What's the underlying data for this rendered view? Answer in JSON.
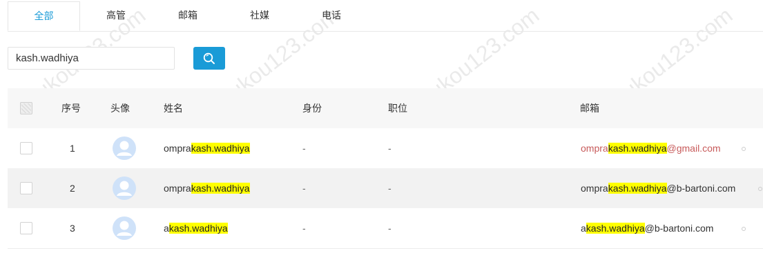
{
  "tabs": [
    {
      "label": "全部",
      "active": true
    },
    {
      "label": "高管",
      "active": false
    },
    {
      "label": "邮箱",
      "active": false
    },
    {
      "label": "社媒",
      "active": false
    },
    {
      "label": "电话",
      "active": false
    }
  ],
  "search": {
    "value": "kash.wadhiya",
    "button_icon": "search-icon"
  },
  "table": {
    "headers": {
      "index": "序号",
      "avatar": "头像",
      "name": "姓名",
      "identity": "身份",
      "position": "职位",
      "email": "邮箱"
    },
    "rows": [
      {
        "index": "1",
        "name_prefix": "ompra",
        "name_hl": "kash.wadhiya",
        "identity": "-",
        "position": "-",
        "email_prefix": "ompra",
        "email_hl": "kash.wadhiya",
        "email_suffix": "@gmail.com"
      },
      {
        "index": "2",
        "name_prefix": "ompra",
        "name_hl": "kash.wadhiya",
        "identity": "-",
        "position": "-",
        "email_prefix": "ompra",
        "email_hl": "kash.wadhiya",
        "email_suffix": "@b-bartoni.com"
      },
      {
        "index": "3",
        "name_prefix": "a",
        "name_hl": "kash.wadhiya",
        "identity": "-",
        "position": "-",
        "email_prefix": "a",
        "email_hl": "kash.wadhiya",
        "email_suffix": "@b-bartoni.com"
      }
    ]
  },
  "watermark": "chukou123.com",
  "colors": {
    "accent": "#1a9bd7",
    "highlight": "#ffff00",
    "avatar": "#cfe2f9"
  }
}
